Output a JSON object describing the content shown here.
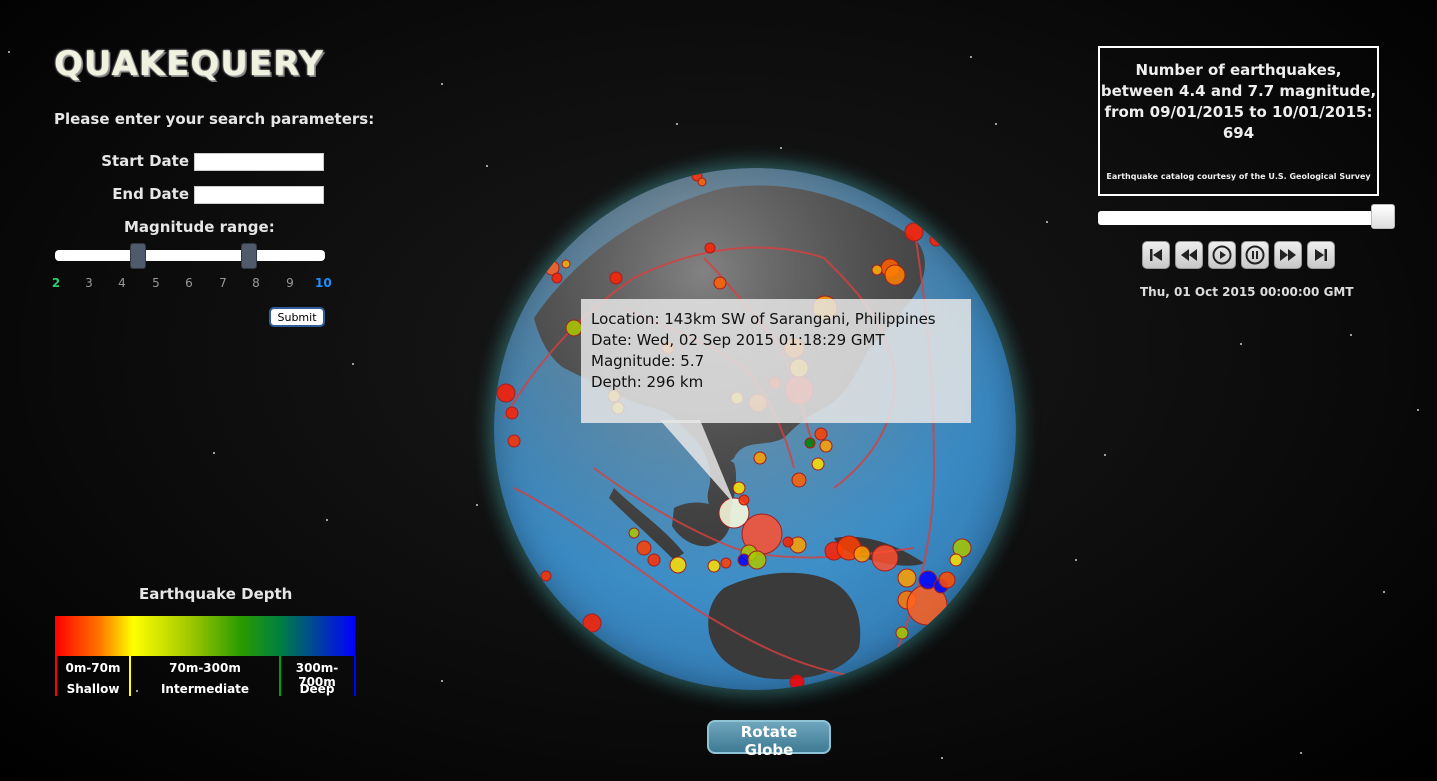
{
  "app": {
    "logo": "QUAKEQUERY",
    "prompt": "Please enter your search parameters:"
  },
  "search": {
    "start_label": "Start Date",
    "start_value": "",
    "end_label": "End Date",
    "end_value": "",
    "magnitude_label": "Magnitude range:",
    "ticks": [
      "2",
      "3",
      "4",
      "5",
      "6",
      "7",
      "8",
      "9",
      "10"
    ],
    "range_low": 4.4,
    "range_high": 7.7,
    "submit_label": "Submit"
  },
  "legend": {
    "title": "Earthquake Depth",
    "items": [
      {
        "range": "0m-70m",
        "name": "Shallow"
      },
      {
        "range": "70m-300m",
        "name": "Intermediate"
      },
      {
        "range": "300m-700m",
        "name": "Deep"
      }
    ],
    "colors": [
      "#ff0000",
      "#ffff00",
      "#008000",
      "#0000ff"
    ]
  },
  "tooltip": {
    "location": "Location: 143km SW of Sarangani, Philippines",
    "date": "Date: Wed, 02 Sep 2015 01:18:29 GMT",
    "magnitude": "Magnitude: 5.7",
    "depth": "Depth: 296 km"
  },
  "globe": {
    "rotate_label": "Rotate Globe"
  },
  "summary": {
    "line1": "Number of earthquakes,",
    "line2": "between 4.4 and 7.7 magnitude,",
    "line3": "from 09/01/2015 to 10/01/2015:",
    "count": "694",
    "credit": "Earthquake catalog courtesy of the U.S. Geological Survey"
  },
  "timeline": {
    "position": 1.0,
    "timestamp": "Thu, 01 Oct 2015 00:00:00 GMT",
    "controls": [
      "skip-back-icon",
      "rewind-icon",
      "play-icon",
      "pause-icon",
      "fast-forward-icon",
      "skip-forward-icon"
    ]
  }
}
